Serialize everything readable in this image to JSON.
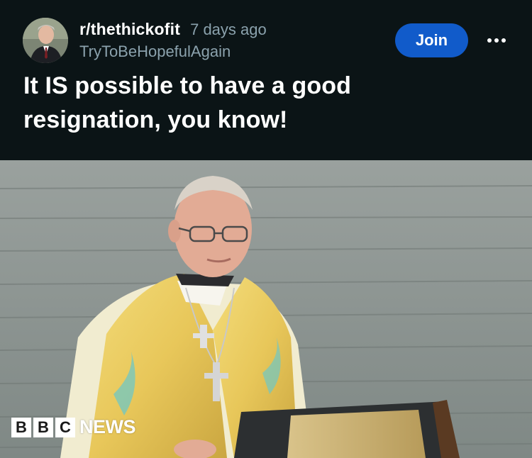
{
  "post": {
    "subreddit": "r/thethickofit",
    "time_ago": "7 days ago",
    "author": "TryToBeHopefulAgain",
    "join_label": "Join",
    "more_icon": "ellipsis-horizontal-icon",
    "title": "It IS possible to have a good resignation, you know!"
  },
  "media": {
    "watermark_blocks": [
      "B",
      "B",
      "C"
    ],
    "watermark_word": "NEWS"
  },
  "colors": {
    "background": "#0b1416",
    "join_button": "#115bca",
    "meta_text": "#8ba2ad"
  }
}
